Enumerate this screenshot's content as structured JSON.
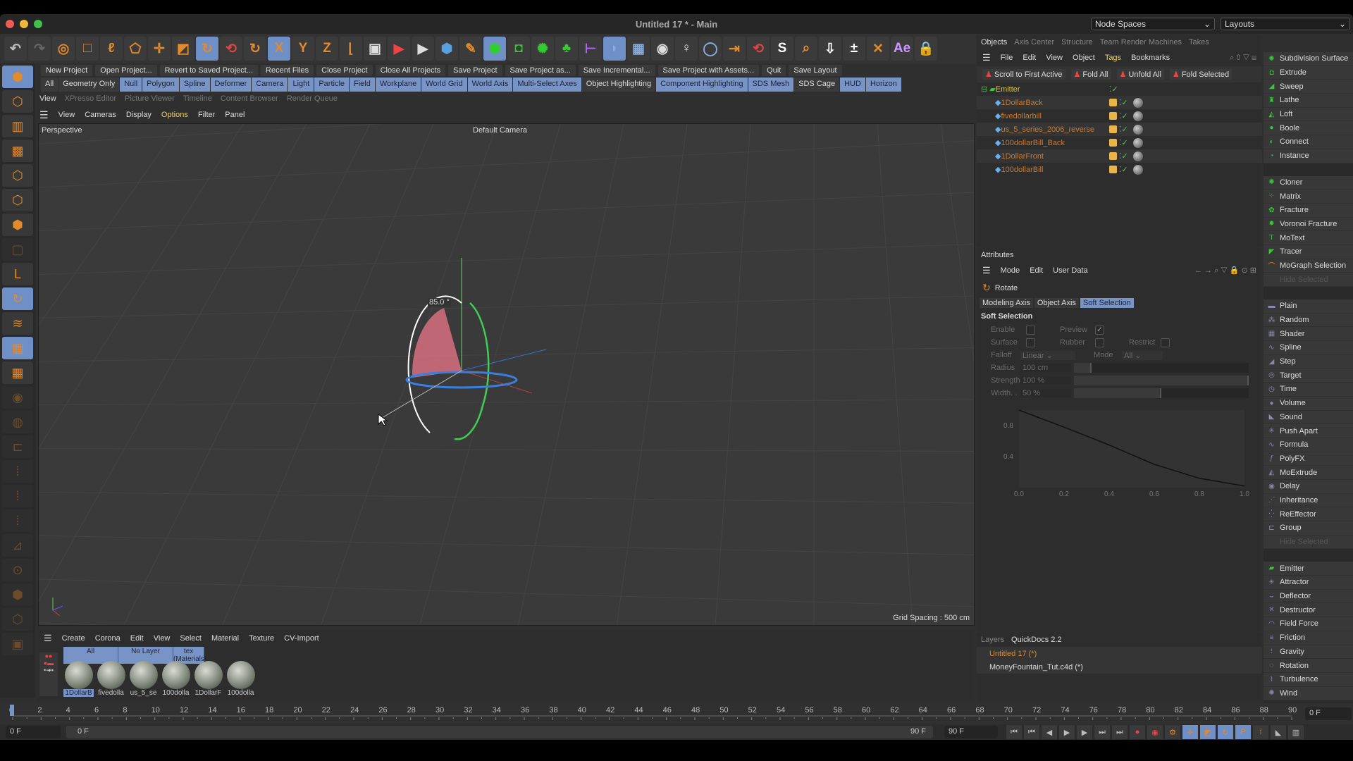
{
  "window": {
    "title": "Untitled 17 * - Main",
    "node_spaces": "Node Spaces",
    "layouts": "Layouts"
  },
  "toolbar_icons": [
    {
      "name": "undo-icon",
      "g": "↶",
      "c": "#bbb"
    },
    {
      "name": "redo-icon",
      "g": "↷",
      "c": "#666"
    },
    {
      "name": "live-selection-icon",
      "g": "◎",
      "c": "#e38a2c"
    },
    {
      "name": "rectangle-selection-icon",
      "g": "□",
      "c": "#e38a2c"
    },
    {
      "name": "lasso-selection-icon",
      "g": "ℓ",
      "c": "#e38a2c"
    },
    {
      "name": "polygon-selection-icon",
      "g": "⬠",
      "c": "#e38a2c"
    },
    {
      "name": "move-icon",
      "g": "✛",
      "c": "#e38a2c"
    },
    {
      "name": "scale-icon",
      "g": "◩",
      "c": "#e38a2c"
    },
    {
      "name": "rotate-icon",
      "g": "↻",
      "c": "#e38a2c",
      "on": true
    },
    {
      "name": "psr-reset-icon",
      "g": "⟲",
      "c": "#d44"
    },
    {
      "name": "recent-tool-icon",
      "g": "↻",
      "c": "#e38a2c"
    },
    {
      "name": "x-axis-icon",
      "g": "X",
      "c": "#e38a2c",
      "on": true
    },
    {
      "name": "y-axis-icon",
      "g": "Y",
      "c": "#e38a2c"
    },
    {
      "name": "z-axis-icon",
      "g": "Z",
      "c": "#e38a2c"
    },
    {
      "name": "coordinate-system-icon",
      "g": "⌊",
      "c": "#e38a2c"
    },
    {
      "name": "render-view-icon",
      "g": "▣",
      "c": "#ddd"
    },
    {
      "name": "render-picture-viewer-icon",
      "g": "▶",
      "c": "#e44"
    },
    {
      "name": "render-settings-icon",
      "g": "▶",
      "c": "#ddd"
    },
    {
      "name": "cube-icon",
      "g": "⬢",
      "c": "#5aa0e0"
    },
    {
      "name": "pen-icon",
      "g": "✎",
      "c": "#e38a2c"
    },
    {
      "name": "subdivision-icon",
      "g": "⬢",
      "c": "#3c3",
      "on": true
    },
    {
      "name": "extrude-icon",
      "g": "◘",
      "c": "#3c3"
    },
    {
      "name": "cloner-icon",
      "g": "✺",
      "c": "#3c3"
    },
    {
      "name": "matrix-icon",
      "g": "♣",
      "c": "#3c3"
    },
    {
      "name": "deformer-icon",
      "g": "⊢",
      "c": "#b6f"
    },
    {
      "name": "field-icon",
      "g": "◗",
      "c": "#8ad",
      "on": true
    },
    {
      "name": "floor-icon",
      "g": "▦",
      "c": "#8ad"
    },
    {
      "name": "camera-icon",
      "g": "◉",
      "c": "#ddd"
    },
    {
      "name": "light-icon",
      "g": "♀",
      "c": "#ddd"
    },
    {
      "name": "workplane-icon",
      "g": "◯",
      "c": "#8ad"
    },
    {
      "name": "xyz-lock-icon",
      "g": "⇥",
      "c": "#e38a2c"
    },
    {
      "name": "psr-icon",
      "g": "⟲",
      "c": "#d44"
    },
    {
      "name": "script-s-icon",
      "g": "S",
      "c": "#fff"
    },
    {
      "name": "search-plugin-icon",
      "g": "⌕",
      "c": "#e38a2c"
    },
    {
      "name": "download-icon",
      "g": "⇩",
      "c": "#fff"
    },
    {
      "name": "plus-minus-icon",
      "g": "±",
      "c": "#fff"
    },
    {
      "name": "explode-icon",
      "g": "✕",
      "c": "#e38a2c"
    },
    {
      "name": "after-effects-icon",
      "g": "Ae",
      "c": "#c9f"
    },
    {
      "name": "lock-icon",
      "g": "🔒",
      "c": "#e44"
    }
  ],
  "command_bar": [
    "New Project",
    "Open Project...",
    "Revert to Saved Project...",
    "Recent Files",
    "Close Project",
    "Close All Projects",
    "Save Project",
    "Save Project as...",
    "Save Incremental...",
    "Save Project with Assets...",
    "Quit",
    "Save Layout"
  ],
  "filter_bar": [
    {
      "label": "All",
      "on": false
    },
    {
      "label": "Geometry Only",
      "on": false
    },
    {
      "label": "Null",
      "on": true
    },
    {
      "label": "Polygon",
      "on": true
    },
    {
      "label": "Spline",
      "on": true
    },
    {
      "label": "Deformer",
      "on": true
    },
    {
      "label": "Camera",
      "on": true
    },
    {
      "label": "Light",
      "on": true
    },
    {
      "label": "Particle",
      "on": true
    },
    {
      "label": "Field",
      "on": true
    },
    {
      "label": "Workplane",
      "on": true
    },
    {
      "label": "World Grid",
      "on": true
    },
    {
      "label": "World Axis",
      "on": true
    },
    {
      "label": "Multi-Select Axes",
      "on": true
    },
    {
      "label": "Object Highlighting",
      "on": false
    },
    {
      "label": "Component Highlighting",
      "on": true
    },
    {
      "label": "SDS Mesh",
      "on": true
    },
    {
      "label": "SDS Cage",
      "on": false
    },
    {
      "label": "HUD",
      "on": true
    },
    {
      "label": "Horizon",
      "on": true
    }
  ],
  "left_tools": [
    {
      "name": "model-mode-icon",
      "g": "⬢",
      "on": true
    },
    {
      "name": "object-mode-icon",
      "g": "⬡"
    },
    {
      "name": "texture-mode-icon",
      "g": "▥"
    },
    {
      "name": "texture-edit-icon",
      "g": "▩"
    },
    {
      "name": "points-mode-icon",
      "g": "⬡"
    },
    {
      "name": "edges-mode-icon",
      "g": "⬡"
    },
    {
      "name": "polygons-mode-icon",
      "g": "⬢"
    },
    {
      "name": "uv-mode-icon",
      "g": "▢",
      "dim": true
    },
    {
      "name": "axis-mode-icon",
      "g": "L"
    },
    {
      "name": "tweak-mode-icon",
      "g": "↻",
      "on": true
    },
    {
      "name": "solo-icon",
      "g": "≋"
    },
    {
      "name": "snap-icon",
      "g": "▦",
      "on": true
    },
    {
      "name": "workplane-mode-icon",
      "g": "▦"
    },
    {
      "name": "lock-workplane-icon",
      "g": "◉",
      "dim": true
    },
    {
      "name": "sculpt-icon",
      "g": "◍",
      "dim": true
    },
    {
      "name": "planar-icon",
      "g": "⊏",
      "dim": true
    },
    {
      "name": "grid-icon",
      "g": "⁞",
      "dim": true
    },
    {
      "name": "guides-icon",
      "g": "⁞",
      "dim": true
    },
    {
      "name": "quantize-icon",
      "g": "⁞",
      "dim": true
    },
    {
      "name": "paint-icon",
      "g": "⊿",
      "dim": true
    },
    {
      "name": "enable-axis-icon",
      "g": "⊙",
      "dim": true
    },
    {
      "name": "vertex-paint-icon",
      "g": "⬢",
      "dim": true
    },
    {
      "name": "magnet-icon",
      "g": "⬡",
      "dim": true
    },
    {
      "name": "misc-icon",
      "g": "▣",
      "dim": true
    }
  ],
  "view_tabs": [
    {
      "label": "View",
      "act": true
    },
    {
      "label": "XPresso Editor"
    },
    {
      "label": "Picture Viewer"
    },
    {
      "label": "Timeline"
    },
    {
      "label": "Content Browser"
    },
    {
      "label": "Render Queue"
    }
  ],
  "view_menu": [
    {
      "label": "View"
    },
    {
      "label": "Cameras"
    },
    {
      "label": "Display"
    },
    {
      "label": "Options",
      "hl": true
    },
    {
      "label": "Filter"
    },
    {
      "label": "Panel"
    }
  ],
  "viewport": {
    "name": "Perspective",
    "camera": "Default Camera",
    "angle": "85.0 °",
    "grid_spacing": "Grid Spacing : 500 cm"
  },
  "objects": {
    "tabs": [
      "Objects",
      "Axis Center",
      "Structure",
      "Team Render Machines",
      "Takes"
    ],
    "menu": [
      "File",
      "Edit",
      "View",
      "Object",
      "Tags",
      "Bookmarks"
    ],
    "buttons": [
      "Scroll to First Active",
      "Fold All",
      "Unfold All",
      "Fold Selected"
    ],
    "root": "Emitter",
    "children": [
      "1DollarBack",
      "fivedollarbill",
      "us_5_series_2006_reverse",
      "100dollarBill_Back",
      "1DollarFront",
      "100dollarBill"
    ]
  },
  "attributes": {
    "title": "Attributes",
    "menu": [
      "Mode",
      "Edit",
      "User Data"
    ],
    "tool": "Rotate",
    "tabs": [
      "Modeling Axis",
      "Object Axis",
      "Soft Selection"
    ],
    "section": "Soft Selection",
    "enable": "Enable",
    "preview": "Preview",
    "surface": "Surface",
    "rubber": "Rubber",
    "restrict": "Restrict",
    "falloff_label": "Falloff",
    "falloff_value": "Linear",
    "mode_label": "Mode",
    "mode_value": "All",
    "radius_label": "Radius",
    "radius_value": "100 cm",
    "radius_fraction": 0.1,
    "strength_label": "Strength",
    "strength_value": "100 %",
    "strength_fraction": 1.0,
    "width_label": "Width. .",
    "width_value": "50 %",
    "width_fraction": 0.5,
    "curve_y_ticks": [
      "0.8",
      "0.4"
    ],
    "curve_x_ticks": [
      "0.0",
      "0.2",
      "0.4",
      "0.6",
      "0.8",
      "1.0"
    ],
    "curve_points": [
      [
        0,
        1
      ],
      [
        0.2,
        0.78
      ],
      [
        0.4,
        0.55
      ],
      [
        0.6,
        0.3
      ],
      [
        0.8,
        0.12
      ],
      [
        1,
        0.02
      ]
    ],
    "preview_checked": true
  },
  "palette": [
    [
      {
        "l": "Subdivision Surface",
        "i": "✺",
        "c": "#3c3"
      },
      {
        "l": "Extrude",
        "i": "◘",
        "c": "#3c3"
      },
      {
        "l": "Sweep",
        "i": "◢",
        "c": "#3c3"
      },
      {
        "l": "Lathe",
        "i": "♜",
        "c": "#3c3"
      },
      {
        "l": "Loft",
        "i": "◭",
        "c": "#3c3"
      },
      {
        "l": "Boole",
        "i": "●",
        "c": "#3c3"
      },
      {
        "l": "Connect",
        "i": "◐",
        "c": "#3c3"
      },
      {
        "l": "Instance",
        "i": "◔",
        "c": "#3c3"
      }
    ],
    [
      {
        "l": "Cloner",
        "i": "✺",
        "c": "#3c3"
      },
      {
        "l": "Matrix",
        "i": "⁘",
        "c": "#3c3"
      },
      {
        "l": "Fracture",
        "i": "✿",
        "c": "#3c3"
      },
      {
        "l": "Voronoi Fracture",
        "i": "✹",
        "c": "#3c3"
      },
      {
        "l": "MoText",
        "i": "T",
        "c": "#3c3"
      },
      {
        "l": "Tracer",
        "i": "◤",
        "c": "#3c3"
      },
      {
        "l": "MoGraph Selection",
        "i": "⌒",
        "c": "#e38a2c"
      },
      {
        "l": "Hide Selected",
        "i": "",
        "c": "#555",
        "dim": true
      }
    ],
    [
      {
        "l": "Plain",
        "i": "▬",
        "c": "#88a"
      },
      {
        "l": "Random",
        "i": "⁂",
        "c": "#88a"
      },
      {
        "l": "Shader",
        "i": "▦",
        "c": "#88a"
      },
      {
        "l": "Spline",
        "i": "∿",
        "c": "#88a"
      },
      {
        "l": "Step",
        "i": "◢",
        "c": "#88a"
      },
      {
        "l": "Target",
        "i": "◎",
        "c": "#88a"
      },
      {
        "l": "Time",
        "i": "◷",
        "c": "#88a"
      },
      {
        "l": "Volume",
        "i": "●",
        "c": "#88a"
      },
      {
        "l": "Sound",
        "i": "◣",
        "c": "#88a"
      },
      {
        "l": "Push Apart",
        "i": "✳",
        "c": "#88a"
      },
      {
        "l": "Formula",
        "i": "∿",
        "c": "#88a"
      },
      {
        "l": "PolyFX",
        "i": "ƒ",
        "c": "#88a"
      },
      {
        "l": "MoExtrude",
        "i": "◭",
        "c": "#88a"
      },
      {
        "l": "Delay",
        "i": "◉",
        "c": "#88a"
      },
      {
        "l": "Inheritance",
        "i": "⋰",
        "c": "#88a"
      },
      {
        "l": "ReEffector",
        "i": "⁛",
        "c": "#88a"
      },
      {
        "l": "Group",
        "i": "⊏",
        "c": "#88a"
      },
      {
        "l": "Hide Selected",
        "i": "",
        "c": "#555",
        "dim": true
      }
    ],
    [
      {
        "l": "Emitter",
        "i": "▰",
        "c": "#3c3"
      },
      {
        "l": "Attractor",
        "i": "✳",
        "c": "#88a"
      },
      {
        "l": "Deflector",
        "i": "⌣",
        "c": "#88a"
      },
      {
        "l": "Destructor",
        "i": "✕",
        "c": "#88a"
      },
      {
        "l": "Field Force",
        "i": "◠",
        "c": "#88a"
      },
      {
        "l": "Friction",
        "i": "≡",
        "c": "#88a"
      },
      {
        "l": "Gravity",
        "i": "⁝",
        "c": "#88a"
      },
      {
        "l": "Rotation",
        "i": "◌",
        "c": "#88a"
      },
      {
        "l": "Turbulence",
        "i": "⌇",
        "c": "#88a"
      },
      {
        "l": "Wind",
        "i": "✺",
        "c": "#88a"
      }
    ]
  ],
  "materials": {
    "menu": [
      "Create",
      "Corona",
      "Edit",
      "View",
      "Select",
      "Material",
      "Texture",
      "CV-Import"
    ],
    "filters": [
      "All",
      "No Layer",
      "tex (Materials)"
    ],
    "items": [
      "1DollarB",
      "fivedolla",
      "us_5_se",
      "100dolla",
      "1DollarF",
      "100dolla"
    ]
  },
  "layers": {
    "tabs": [
      "Layers",
      "QuickDocs 2.2"
    ],
    "docs": [
      "Untitled 17 (*)",
      "MoneyFountain_Tut.c4d (*)"
    ]
  },
  "timeline": {
    "ticks": [
      0,
      2,
      4,
      6,
      8,
      10,
      12,
      14,
      16,
      18,
      20,
      22,
      24,
      26,
      28,
      30,
      32,
      34,
      36,
      38,
      40,
      42,
      44,
      46,
      48,
      50,
      52,
      54,
      56,
      58,
      60,
      62,
      64,
      66,
      68,
      70,
      72,
      74,
      76,
      78,
      80,
      82,
      84,
      86,
      88,
      90
    ],
    "current": "0 F",
    "start": "0 F",
    "range_start": "0 F",
    "range_end": "90 F",
    "end": "90 F",
    "current_frame": 0
  },
  "colors": {
    "accent": "#7893c6",
    "orange": "#e38a2c",
    "object_name": "#c77a34",
    "emitter_name": "#d4c24a"
  }
}
